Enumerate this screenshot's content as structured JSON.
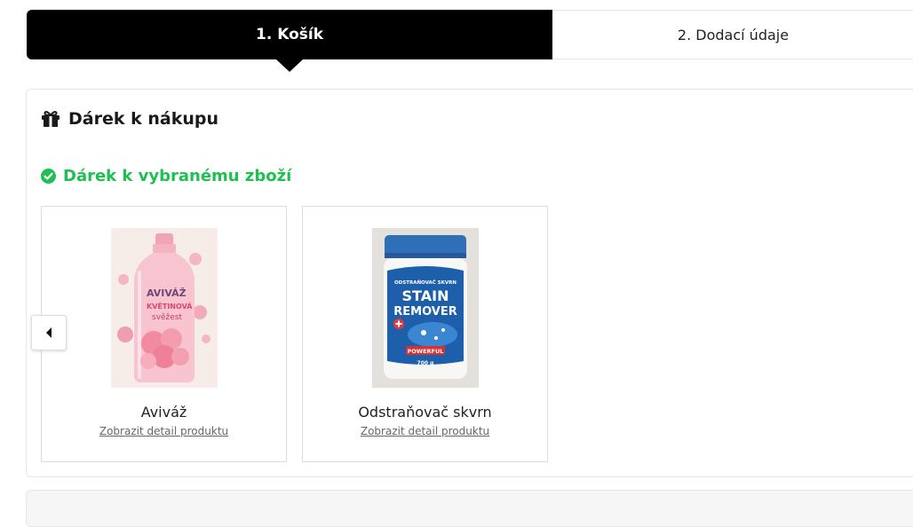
{
  "steps": [
    {
      "label": "1. Košík",
      "active": true
    },
    {
      "label": "2. Dodací údaje",
      "active": false
    }
  ],
  "gift": {
    "title": "Dárek k nákupu",
    "title_icon": "gift-icon",
    "section_title": "Dárek k vybranému zboží",
    "section_icon": "check-circle-icon",
    "section_color": "#1fbf52"
  },
  "products": [
    {
      "name": "Aviváž",
      "link": "Zobrazit detail produktu",
      "image_text": {
        "line1": "AVIVÁŽ",
        "line2": "KVĚTINOVÁ",
        "line3": "svěžest"
      }
    },
    {
      "name": "Odstraňovač skvrn",
      "link": "Zobrazit detail produktu",
      "image_text": {
        "band": "ODSTRAŇOVAČ SKVRN",
        "line1": "STAIN",
        "line2": "REMOVER",
        "badge": "POWERFUL",
        "weight": "700 g"
      }
    }
  ],
  "carousel": {
    "prev_icon": "caret-left-icon"
  },
  "colors": {
    "step_active_bg": "#000000",
    "accent_green": "#1fbf52"
  }
}
